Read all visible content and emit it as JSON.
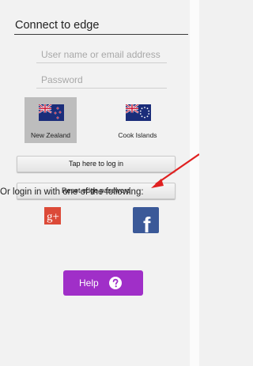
{
  "header": {
    "title": "Connect to edge"
  },
  "form": {
    "username_placeholder": "User name or email address",
    "password_placeholder": "Password"
  },
  "countries": [
    {
      "label": "New Zealand",
      "selected": true
    },
    {
      "label": "Cook Islands",
      "selected": false
    }
  ],
  "buttons": {
    "login": "Tap here to log in",
    "reset": "Reset edge password",
    "help": "Help"
  },
  "social": {
    "prompt": "Or login in with one of the following:",
    "google_label": "g+",
    "facebook_label": "f"
  },
  "icons": {
    "google": "google-plus-icon",
    "facebook": "facebook-icon",
    "help": "question-mark-icon",
    "annotation": "red-arrow-icon"
  },
  "colors": {
    "google": "#dc4a38",
    "facebook": "#3b5998",
    "help": "#a02fc8",
    "annotation": "#e02020"
  }
}
